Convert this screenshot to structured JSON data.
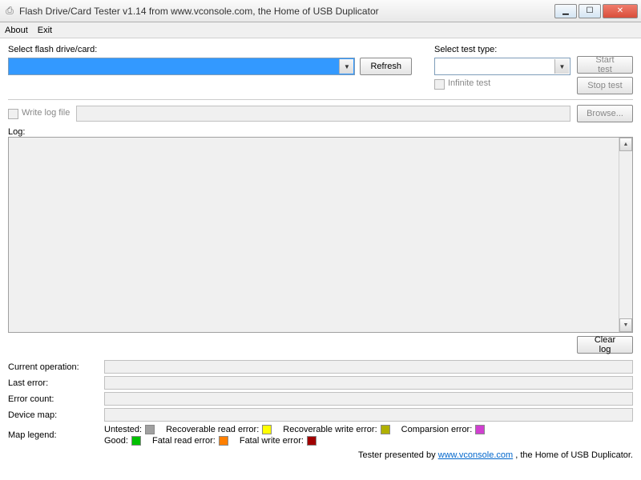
{
  "window": {
    "title": "Flash Drive/Card Tester v1.14 from www.vconsole.com, the Home of USB Duplicator"
  },
  "menu": {
    "about": "About",
    "exit": "Exit"
  },
  "controls": {
    "select_drive_label": "Select flash drive/card:",
    "refresh": "Refresh",
    "select_test_label": "Select test type:",
    "infinite_test": "Infinite test",
    "start_test": "Start test",
    "stop_test": "Stop test",
    "write_log_file": "Write log file",
    "browse": "Browse...",
    "log_label": "Log:",
    "clear_log": "Clear log"
  },
  "status": {
    "current_op_label": "Current operation:",
    "last_error_label": "Last error:",
    "error_count_label": "Error count:",
    "device_map_label": "Device map:"
  },
  "legend": {
    "title": "Map legend:",
    "items": [
      {
        "label": "Untested:",
        "color": "#a0a0a0"
      },
      {
        "label": "Recoverable read error:",
        "color": "#ffff00"
      },
      {
        "label": "Recoverable write error:",
        "color": "#b0b000"
      },
      {
        "label": "Comparsion error:",
        "color": "#d040d0"
      },
      {
        "label": "Good:",
        "color": "#00c000"
      },
      {
        "label": "Fatal read error:",
        "color": "#ff7f00"
      },
      {
        "label": "Fatal write error:",
        "color": "#a00000"
      }
    ]
  },
  "footer": {
    "prefix": "Tester presented by ",
    "link": "www.vconsole.com",
    "suffix": " , the Home of USB Duplicator."
  }
}
